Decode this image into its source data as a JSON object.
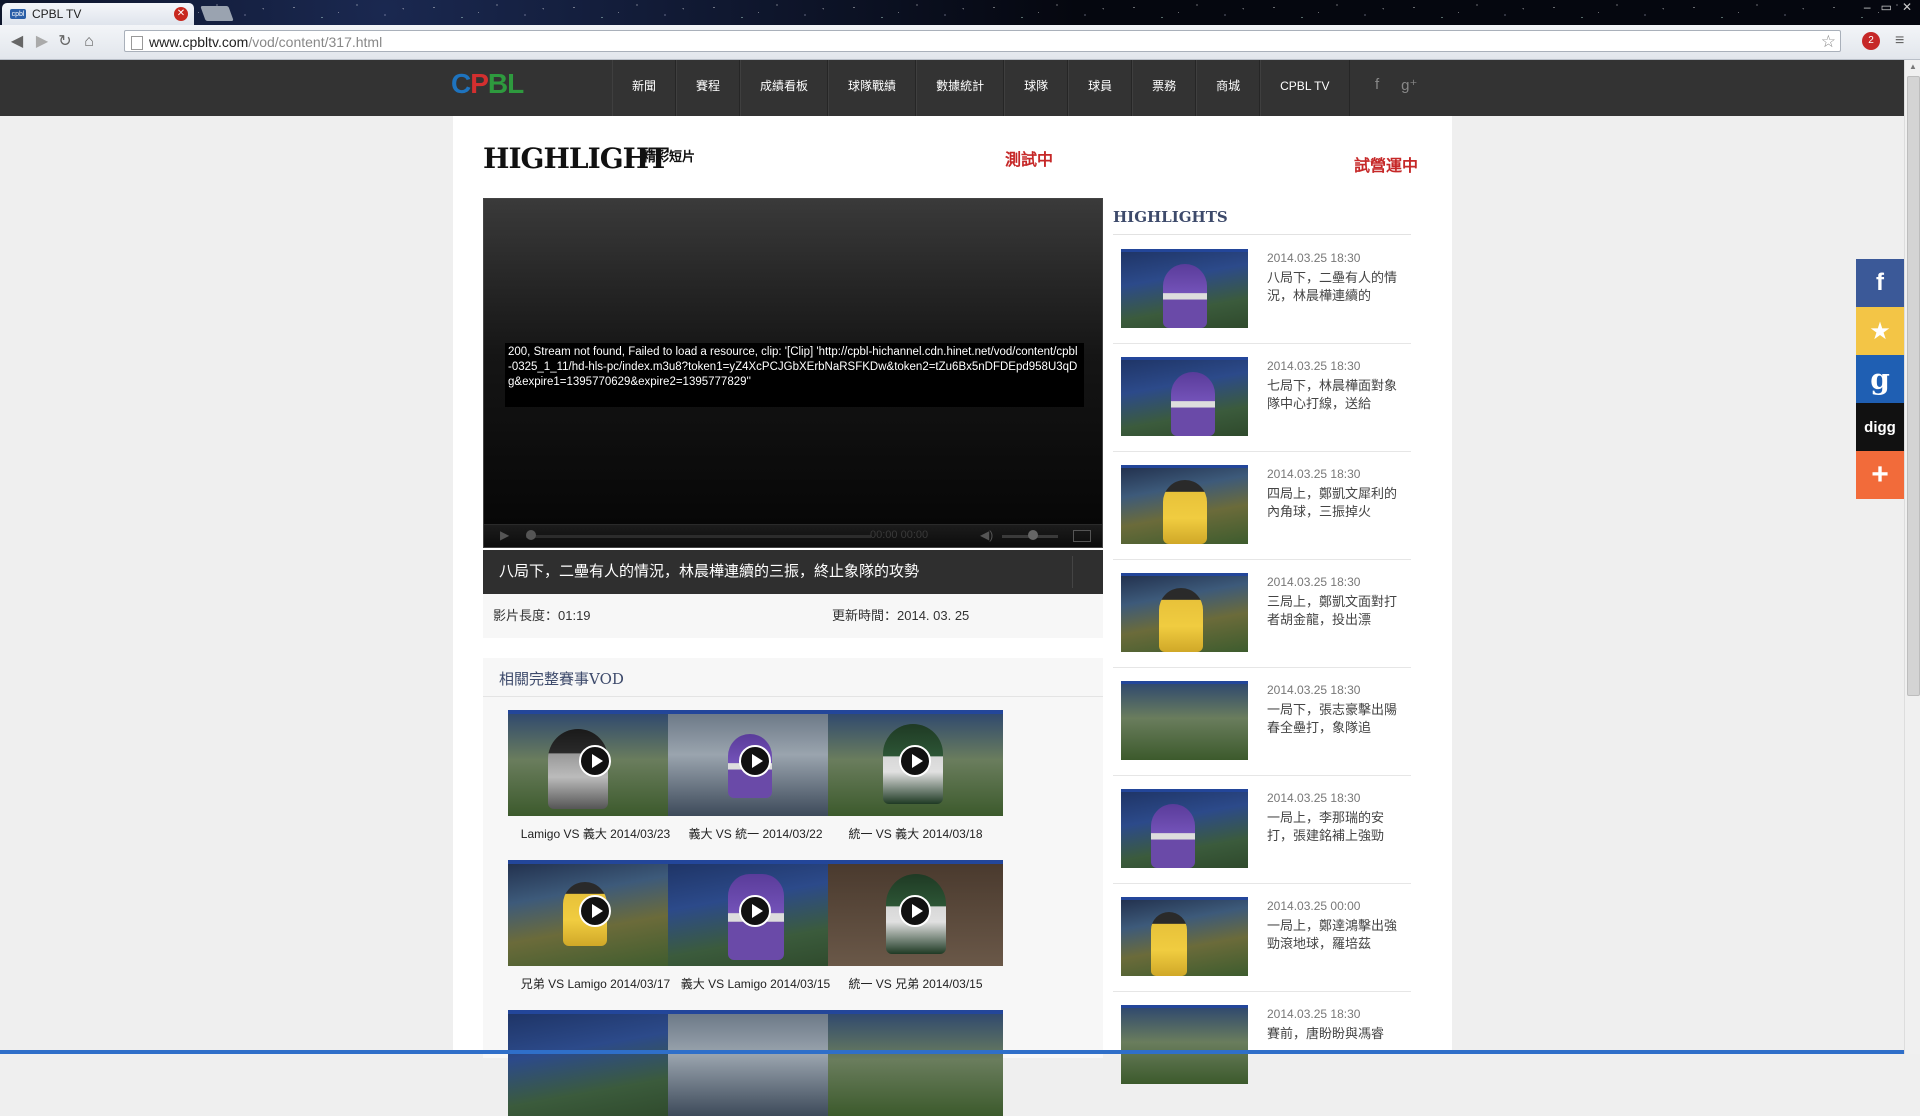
{
  "browser": {
    "tab_title": "CPBL TV",
    "tab_favicon_text": "cpbl",
    "url_host": "www.cpbltv.com",
    "url_path": "/vod/content/317.html",
    "window_controls": [
      "–",
      "▭",
      "✕"
    ],
    "extension_badge": "2"
  },
  "site": {
    "logo_letters": [
      "C",
      "P",
      "BL"
    ],
    "nav": [
      "新聞",
      "賽程",
      "成績看板",
      "球隊戰績",
      "數據統計",
      "球隊",
      "球員",
      "票務",
      "商城",
      "CPBL TV"
    ],
    "social_top": [
      "f",
      "g⁺"
    ]
  },
  "page": {
    "title": "HIGHLIGHT",
    "subtitle": "精彩短片",
    "testing": "測試中",
    "trial": "試營運中"
  },
  "player": {
    "error": "200, Stream not found, Failed to load a resource, clip: '[Clip] 'http://cpbl-hichannel.cdn.hinet.net/vod/content/cpbl-0325_1_11/hd-hls-pc/index.m3u8?token1=yZ4XcPCJGbXErbNaRSFKDw&token2=tZu6Bx5nDFDEpd958U3qDg&expire1=1395770629&expire2=1395777829''",
    "time": "00:00  00:00",
    "caption": "八局下，二壘有人的情況，林晨樺連續的三振，終止象隊的攻勢",
    "length_label": "影片長度：01:19",
    "updated_label": "更新時間：2014. 03. 25"
  },
  "vod": {
    "title": "相關完整賽事VOD",
    "items": [
      {
        "label": "Lamigo VS 義大 2014/03/23"
      },
      {
        "label": "義大 VS 統一 2014/03/22"
      },
      {
        "label": "統一 VS 義大 2014/03/18"
      },
      {
        "label": "兄弟 VS Lamigo 2014/03/17"
      },
      {
        "label": "義大 VS Lamigo 2014/03/15"
      },
      {
        "label": "統一 VS 兄弟 2014/03/15"
      }
    ]
  },
  "highlights": {
    "title": "HIGHLIGHTS",
    "items": [
      {
        "date": "2014.03.25 18:30",
        "text": "八局下，二壘有人的情況，林晨樺連續的"
      },
      {
        "date": "2014.03.25 18:30",
        "text": "七局下，林晨樺面對象隊中心打線，送給"
      },
      {
        "date": "2014.03.25 18:30",
        "text": "四局上，鄭凱文犀利的內角球，三振掉火"
      },
      {
        "date": "2014.03.25 18:30",
        "text": "三局上，鄭凱文面對打者胡金龍，投出漂"
      },
      {
        "date": "2014.03.25 18:30",
        "text": "一局下，張志豪擊出陽春全壘打，象隊追"
      },
      {
        "date": "2014.03.25 18:30",
        "text": "一局上，李那瑞的安打，張建銘補上強勁"
      },
      {
        "date": "2014.03.25 00:00",
        "text": "一局上，鄭達鴻擊出強勁滾地球，羅培茲"
      },
      {
        "date": "2014.03.25 18:30",
        "text": "賽前，唐盼盼與馮睿"
      }
    ]
  },
  "share": {
    "facebook": "f",
    "favorite": "★",
    "google": "g",
    "digg": "digg",
    "more": "+"
  },
  "colors": {
    "accent_red": "#c62828",
    "nav_bg": "#333333",
    "heading_blue": "#3d4a6b",
    "thumb_border": "#23469a"
  }
}
